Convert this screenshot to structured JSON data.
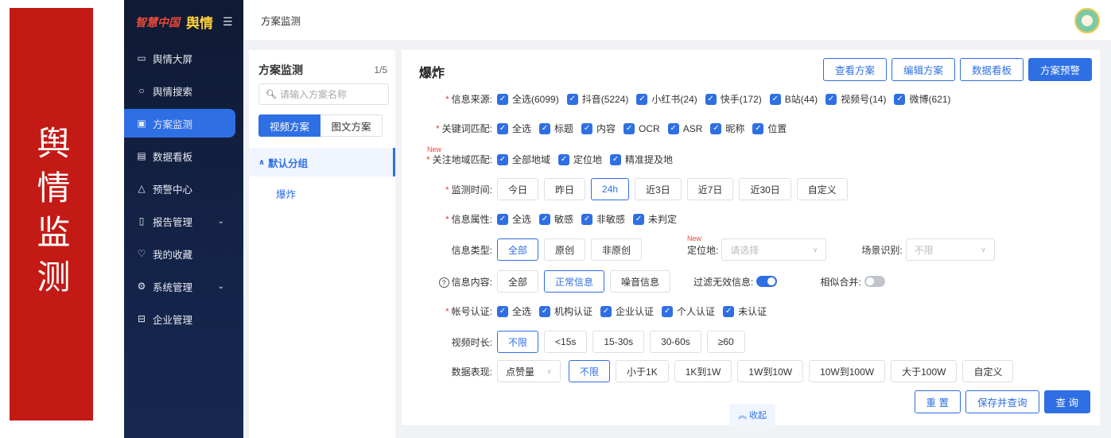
{
  "banner": {
    "text": "舆情监测"
  },
  "sidebar": {
    "logo_brand": "智慧中国",
    "logo_strong": "舆情",
    "items": [
      {
        "label": "舆情大屏",
        "icon": "screen-icon"
      },
      {
        "label": "舆情搜索",
        "icon": "search-icon"
      },
      {
        "label": "方案监测",
        "icon": "monitor-icon",
        "active": true
      },
      {
        "label": "数据看板",
        "icon": "dashboard-icon"
      },
      {
        "label": "预警中心",
        "icon": "alert-icon"
      },
      {
        "label": "报告管理",
        "icon": "report-icon",
        "expandable": true
      },
      {
        "label": "我的收藏",
        "icon": "heart-icon"
      },
      {
        "label": "系统管理",
        "icon": "settings-icon",
        "expandable": true
      },
      {
        "label": "企业管理",
        "icon": "enterprise-icon"
      }
    ]
  },
  "topbar": {
    "breadcrumb": "方案监测"
  },
  "plan_panel": {
    "title": "方案监测",
    "count": "1/5",
    "search_placeholder": "请输入方案名称",
    "tabs": [
      "视频方案",
      "图文方案"
    ],
    "group": "默认分组",
    "plans": [
      "爆炸"
    ]
  },
  "main": {
    "title": "爆炸",
    "top_buttons": [
      "查看方案",
      "编辑方案",
      "数据看板",
      "方案预警"
    ],
    "source": {
      "label": "信息来源:",
      "options": [
        "全选(6099)",
        "抖音(5224)",
        "小红书(24)",
        "快手(172)",
        "B站(44)",
        "视频号(14)",
        "微博(621)"
      ]
    },
    "keyword": {
      "label": "关键词匹配:",
      "options": [
        "全选",
        "标题",
        "内容",
        "OCR",
        "ASR",
        "昵称",
        "位置"
      ]
    },
    "region": {
      "new_tag": "New",
      "label": "关注地域匹配:",
      "options": [
        "全部地域",
        "定位地",
        "精准提及地"
      ]
    },
    "time": {
      "label": "监测时间:",
      "options": [
        "今日",
        "昨日",
        "24h",
        "近3日",
        "近7日",
        "近30日",
        "自定义"
      ],
      "selected": "24h"
    },
    "attr": {
      "label": "信息属性:",
      "options": [
        "全选",
        "敏感",
        "非敏感",
        "未判定"
      ]
    },
    "type": {
      "label": "信息类型:",
      "options": [
        "全部",
        "原创",
        "非原创"
      ],
      "selected": "全部",
      "location_new": "New",
      "location_label": "定位地:",
      "location_placeholder": "请选择",
      "scene_label": "场景识别:",
      "scene_value": "不限"
    },
    "content": {
      "label": "信息内容:",
      "options": [
        "全部",
        "正常信息",
        "噪音信息"
      ],
      "selected": "正常信息",
      "filter_label": "过滤无效信息:",
      "filter_on": true,
      "merge_label": "相似合并:",
      "merge_on": false
    },
    "account": {
      "label": "帐号认证:",
      "options": [
        "全选",
        "机构认证",
        "企业认证",
        "个人认证",
        "未认证"
      ]
    },
    "duration": {
      "label": "视频时长:",
      "options": [
        "不限",
        "<15s",
        "15-30s",
        "30-60s",
        "≥60"
      ],
      "selected": "不限"
    },
    "perf": {
      "label": "数据表现:",
      "metric": "点赞量",
      "options": [
        "不限",
        "小于1K",
        "1K到1W",
        "1W到10W",
        "10W到100W",
        "大于100W",
        "自定义"
      ],
      "selected": "不限"
    },
    "bottom_buttons": [
      "重 置",
      "保存并查询",
      "查 询"
    ],
    "collapse": "收起"
  }
}
